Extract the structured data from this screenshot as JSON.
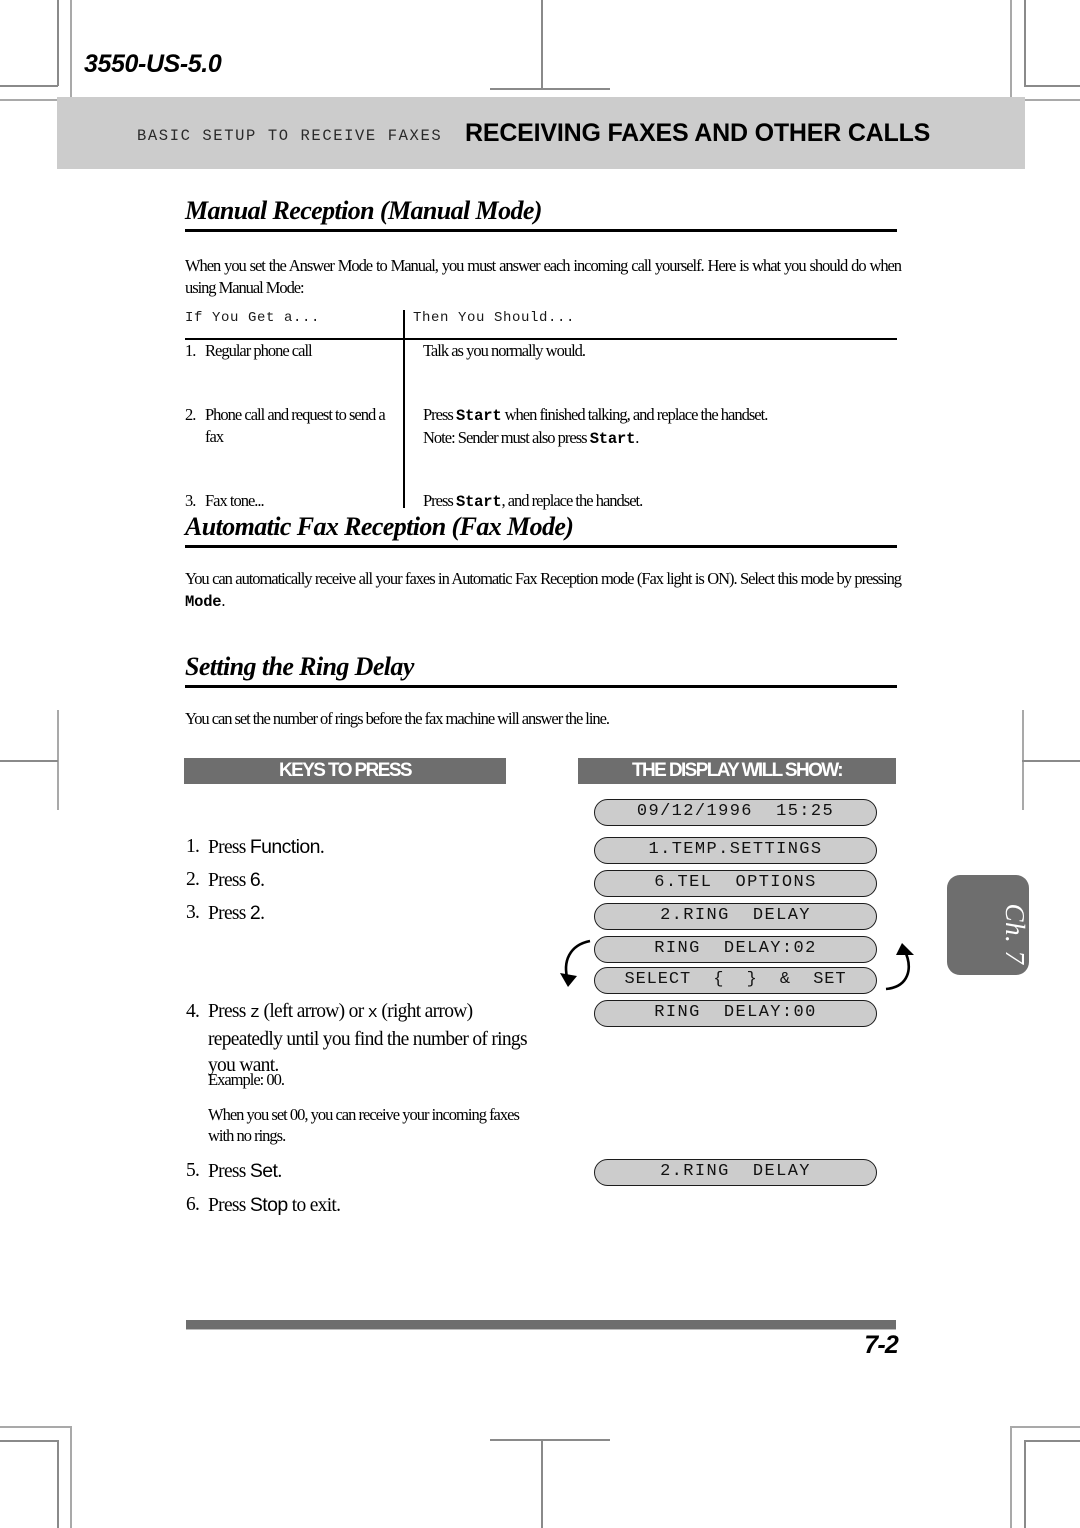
{
  "document": {
    "doc_id": "3550-US-5.0",
    "page_number": "7-2",
    "chapter_tab": "Ch. 7"
  },
  "header": {
    "eyebrow": "BASIC SETUP TO RECEIVE FAXES",
    "title": "RECEIVING FAXES AND OTHER CALLS"
  },
  "sections": {
    "manual": {
      "heading": "Manual Reception (Manual Mode)",
      "intro": "When you set the Answer Mode to Manual, you must answer each incoming call yourself. Here is what you should do when using Manual Mode:",
      "table": {
        "headers": [
          "If  You  Get  a...",
          "Then  You  Should..."
        ],
        "rows": [
          {
            "num": "1.",
            "condition": "Regular phone call",
            "action_lines": [
              "Talk as you normally would."
            ]
          },
          {
            "num": "2.",
            "condition": "Phone call and request to send a fax",
            "action_lines": [
              "Press Start when finished talking, and replace the handset.",
              "Note: Sender must also press Start."
            ]
          },
          {
            "num": "3.",
            "condition": "Fax tone...",
            "action_lines": [
              "Press Start, and replace the handset."
            ]
          }
        ]
      }
    },
    "automatic": {
      "heading": "Automatic Fax Reception (Fax Mode)",
      "body_before": "You can automatically receive all your faxes in Automatic Fax Reception mode (Fax light is ON). Select this mode by pressing ",
      "body_key": "Mode",
      "body_after": "."
    },
    "ring_delay": {
      "heading": "Setting the Ring Delay",
      "intro": "You can set the number of rings before the fax machine will answer the line.",
      "columns": {
        "keys": "KEYS TO PRESS",
        "display": "THE DISPLAY WILL SHOW:"
      },
      "steps": [
        {
          "num": "1.",
          "pre": "Press ",
          "key": "Function",
          "post": "."
        },
        {
          "num": "2.",
          "pre": "Press ",
          "key": "6",
          "post": "."
        },
        {
          "num": "3.",
          "pre": "Press ",
          "key": "2",
          "post": "."
        },
        {
          "num": "4.",
          "pre": "Press ",
          "key_left": "z",
          "mid": " (left arrow) or ",
          "key_right": "x",
          "post": " (right arrow) repeatedly until you find the number of rings you want.",
          "example": "Example: 00.",
          "note": "When you set 00, you can receive your incoming faxes with no rings."
        },
        {
          "num": "5.",
          "pre": "Press ",
          "key": "Set",
          "post": "."
        },
        {
          "num": "6.",
          "pre": "Press ",
          "key": "Stop",
          "post": " to exit."
        }
      ],
      "displays": [
        "09/12/1996  15:25",
        "1.TEMP.SETTINGS",
        "6.TEL  OPTIONS",
        "2.RING  DELAY",
        "RING  DELAY:02",
        "SELECT  {  }  &  SET",
        "RING  DELAY:00",
        "2.RING  DELAY"
      ]
    }
  },
  "colors": {
    "header_band": "#cccccc",
    "column_bar": "#6e6e6e",
    "lcd_fill": "#cccccc",
    "chapter_tab": "#6e6e6e"
  }
}
